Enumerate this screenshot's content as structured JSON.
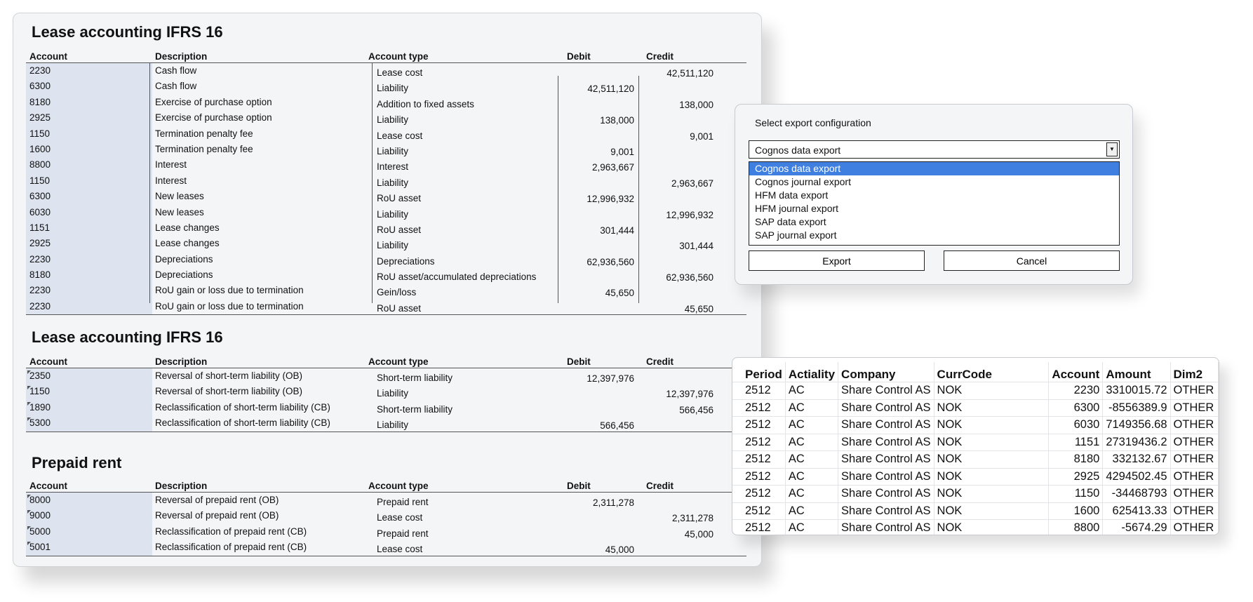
{
  "ledger_columns": {
    "account": "Account",
    "description": "Description",
    "account_type": "Account type",
    "debit": "Debit",
    "credit": "Credit"
  },
  "sections": [
    {
      "title": "Lease accounting IFRS 16",
      "rows": [
        {
          "account": "2230",
          "description": "Cash flow",
          "type": "Lease cost",
          "debit": "",
          "credit": "42,511,120"
        },
        {
          "account": "6300",
          "description": "Cash flow",
          "type": "Liability",
          "debit": "42,511,120",
          "credit": ""
        },
        {
          "account": "8180",
          "description": "Exercise of purchase option",
          "type": "Addition to fixed assets",
          "debit": "",
          "credit": "138,000"
        },
        {
          "account": "2925",
          "description": "Exercise of purchase option",
          "type": "Liability",
          "debit": "138,000",
          "credit": ""
        },
        {
          "account": "1150",
          "description": "Termination penalty fee",
          "type": "Lease cost",
          "debit": "",
          "credit": "9,001"
        },
        {
          "account": "1600",
          "description": "Termination penalty fee",
          "type": "Liability",
          "debit": "9,001",
          "credit": ""
        },
        {
          "account": "8800",
          "description": "Interest",
          "type": "Interest",
          "debit": "2,963,667",
          "credit": ""
        },
        {
          "account": "1150",
          "description": "Interest",
          "type": "Liability",
          "debit": "",
          "credit": "2,963,667"
        },
        {
          "account": "6300",
          "description": "New leases",
          "type": "RoU asset",
          "debit": "12,996,932",
          "credit": ""
        },
        {
          "account": "6030",
          "description": "New leases",
          "type": "Liability",
          "debit": "",
          "credit": "12,996,932"
        },
        {
          "account": "1151",
          "description": "Lease changes",
          "type": "RoU asset",
          "debit": "301,444",
          "credit": ""
        },
        {
          "account": "2925",
          "description": "Lease changes",
          "type": "Liability",
          "debit": "",
          "credit": "301,444"
        },
        {
          "account": "2230",
          "description": "Depreciations",
          "type": "Depreciations",
          "debit": "62,936,560",
          "credit": ""
        },
        {
          "account": "8180",
          "description": "Depreciations",
          "type": "RoU asset/accumulated depreciations",
          "debit": "",
          "credit": "62,936,560"
        },
        {
          "account": "2230",
          "description": "RoU gain or loss due to termination",
          "type": "Gein/loss",
          "debit": "45,650",
          "credit": ""
        },
        {
          "account": "2230",
          "description": "RoU gain or loss due to termination",
          "type": "RoU asset",
          "debit": "",
          "credit": "45,650"
        }
      ]
    },
    {
      "title": "Lease accounting IFRS 16",
      "rows": [
        {
          "account": "2350",
          "description": "Reversal of short-term liability (OB)",
          "type": "Short-term liability",
          "debit": "12,397,976",
          "credit": ""
        },
        {
          "account": "1150",
          "description": "Reversal of short-term liability (OB)",
          "type": "Liability",
          "debit": "",
          "credit": "12,397,976"
        },
        {
          "account": "1890",
          "description": "Reclassification of short-term liability (CB)",
          "type": "Short-term liability",
          "debit": "",
          "credit": "566,456"
        },
        {
          "account": "5300",
          "description": "Reclassification of short-term liability (CB)",
          "type": "Liability",
          "debit": "566,456",
          "credit": ""
        }
      ]
    },
    {
      "title": "Prepaid rent",
      "rows": [
        {
          "account": "8000",
          "description": "Reversal of prepaid rent (OB)",
          "type": "Prepaid rent",
          "debit": "2,311,278",
          "credit": ""
        },
        {
          "account": "9000",
          "description": "Reversal of prepaid rent (OB)",
          "type": "Lease cost",
          "debit": "",
          "credit": "2,311,278"
        },
        {
          "account": "5000",
          "description": "Reclassification of prepaid rent (CB)",
          "type": "Prepaid rent",
          "debit": "",
          "credit": "45,000"
        },
        {
          "account": "5001",
          "description": "Reclassification of prepaid rent (CB)",
          "type": "Lease cost",
          "debit": "45,000",
          "credit": ""
        }
      ]
    }
  ],
  "dialog": {
    "label": "Select export configuration",
    "selected": "Cognos data export",
    "options": [
      "Cognos data export",
      "Cognos journal export",
      "HFM data export",
      "HFM journal export",
      "SAP data export",
      "SAP journal export"
    ],
    "selected_index": 0,
    "export_button": "Export",
    "cancel_button": "Cancel"
  },
  "export_grid": {
    "columns": [
      "Period",
      "Actiality",
      "Company",
      "CurrCode",
      "Account",
      "Amount",
      "Dim2"
    ],
    "rows": [
      [
        "2512",
        "AC",
        "Share Control AS",
        "NOK",
        "2230",
        "3310015.72",
        "OTHER"
      ],
      [
        "2512",
        "AC",
        "Share Control AS",
        "NOK",
        "6300",
        "-8556389.9",
        "OTHER"
      ],
      [
        "2512",
        "AC",
        "Share Control AS",
        "NOK",
        "6030",
        "7149356.68",
        "OTHER"
      ],
      [
        "2512",
        "AC",
        "Share Control AS",
        "NOK",
        "1151",
        "27319436.2",
        "OTHER"
      ],
      [
        "2512",
        "AC",
        "Share Control AS",
        "NOK",
        "8180",
        "332132.67",
        "OTHER"
      ],
      [
        "2512",
        "AC",
        "Share Control AS",
        "NOK",
        "2925",
        "4294502.45",
        "OTHER"
      ],
      [
        "2512",
        "AC",
        "Share Control AS",
        "NOK",
        "1150",
        "-34468793",
        "OTHER"
      ],
      [
        "2512",
        "AC",
        "Share Control AS",
        "NOK",
        "1600",
        "625413.33",
        "OTHER"
      ],
      [
        "2512",
        "AC",
        "Share Control AS",
        "NOK",
        "8800",
        "-5674.29",
        "OTHER"
      ]
    ]
  },
  "colors": {
    "account_column": "#dde4ef",
    "selection": "#3f7fe0",
    "panel": "#f4f5f7"
  }
}
